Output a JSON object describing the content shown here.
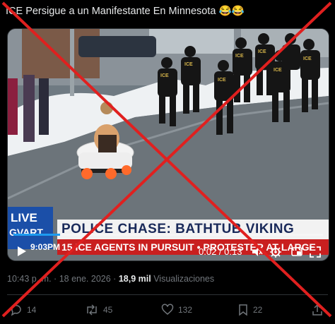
{
  "post": {
    "text": "ICE Persigue a un Manifestante En Minnesota 😂😂"
  },
  "video": {
    "live_label": "LIVE",
    "station_label": "GVART",
    "time_stamp": "9:03PM",
    "headline": "POLICE CHASE: BATHTUB VIKING",
    "ticker": "15 ICE AGENTS IN PURSUIT • PROTESTER AT LARGE",
    "time_text": "0:02 / 0:13",
    "progress": 0.15,
    "play_icon": "play-icon",
    "volume_icon": "volume-icon",
    "settings_icon": "gear-icon",
    "fullscreen_icon": "fullscreen-icon"
  },
  "meta": {
    "time": "10:43 p. m.",
    "separator": "·",
    "date": "18 ene. 2026",
    "views_count": "18,9 mil",
    "views_label": "Visualizaciones"
  },
  "actions": {
    "reply_count": "14",
    "repost_count": "45",
    "like_count": "132",
    "bookmark_count": "22"
  },
  "colors": {
    "background": "#000000",
    "text": "#e7e9ea",
    "muted": "#71767b",
    "overlay_x": "#e0201f",
    "headline_box": "#f2f2f2",
    "ticker_box": "#c91f1f",
    "live_box": "#1b4fa8"
  }
}
